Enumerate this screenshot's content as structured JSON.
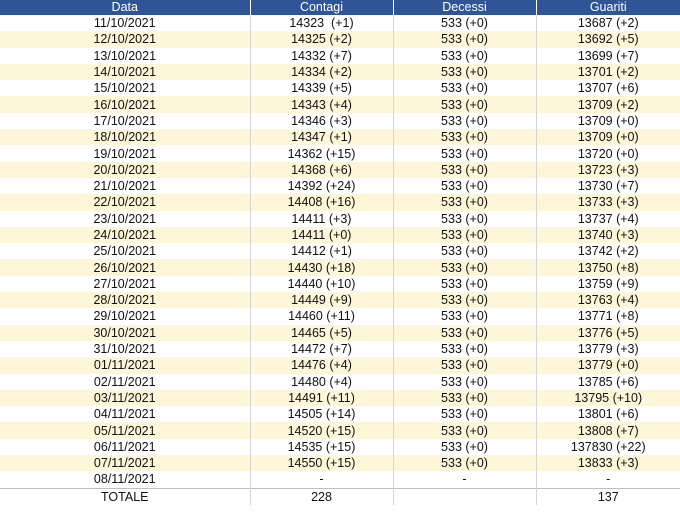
{
  "headers": [
    "Data",
    "Contagi",
    "Decessi",
    "Guariti"
  ],
  "rows": [
    [
      "11/10/2021",
      "14323  (+1)",
      "533 (+0)",
      "13687 (+2)"
    ],
    [
      "12/10/2021",
      "14325 (+2)",
      "533 (+0)",
      "13692 (+5)"
    ],
    [
      "13/10/2021",
      "14332 (+7)",
      "533 (+0)",
      "13699 (+7)"
    ],
    [
      "14/10/2021",
      "14334 (+2)",
      "533 (+0)",
      "13701 (+2)"
    ],
    [
      "15/10/2021",
      "14339 (+5)",
      "533 (+0)",
      "13707 (+6)"
    ],
    [
      "16/10/2021",
      "14343 (+4)",
      "533 (+0)",
      "13709 (+2)"
    ],
    [
      "17/10/2021",
      "14346 (+3)",
      "533 (+0)",
      "13709 (+0)"
    ],
    [
      "18/10/2021",
      "14347 (+1)",
      "533 (+0)",
      "13709 (+0)"
    ],
    [
      "19/10/2021",
      "14362 (+15)",
      "533 (+0)",
      "13720 (+0)"
    ],
    [
      "20/10/2021",
      "14368 (+6)",
      "533 (+0)",
      "13723 (+3)"
    ],
    [
      "21/10/2021",
      "14392 (+24)",
      "533 (+0)",
      "13730 (+7)"
    ],
    [
      "22/10/2021",
      "14408 (+16)",
      "533 (+0)",
      "13733 (+3)"
    ],
    [
      "23/10/2021",
      "14411 (+3)",
      "533 (+0)",
      "13737 (+4)"
    ],
    [
      "24/10/2021",
      "14411 (+0)",
      "533 (+0)",
      "13740 (+3)"
    ],
    [
      "25/10/2021",
      "14412 (+1)",
      "533 (+0)",
      "13742 (+2)"
    ],
    [
      "26/10/2021",
      "14430 (+18)",
      "533 (+0)",
      "13750 (+8)"
    ],
    [
      "27/10/2021",
      "14440 (+10)",
      "533 (+0)",
      "13759 (+9)"
    ],
    [
      "28/10/2021",
      "14449 (+9)",
      "533 (+0)",
      "13763 (+4)"
    ],
    [
      "29/10/2021",
      "14460 (+11)",
      "533 (+0)",
      "13771 (+8)"
    ],
    [
      "30/10/2021",
      "14465 (+5)",
      "533 (+0)",
      "13776 (+5)"
    ],
    [
      "31/10/2021",
      "14472 (+7)",
      "533 (+0)",
      "13779 (+3)"
    ],
    [
      "01/11/2021",
      "14476 (+4)",
      "533 (+0)",
      "13779 (+0)"
    ],
    [
      "02/11/2021",
      "14480 (+4)",
      "533 (+0)",
      "13785 (+6)"
    ],
    [
      "03/11/2021",
      "14491 (+11)",
      "533 (+0)",
      "13795 (+10)"
    ],
    [
      "04/11/2021",
      "14505 (+14)",
      "533 (+0)",
      "13801 (+6)"
    ],
    [
      "05/11/2021",
      "14520 (+15)",
      "533 (+0)",
      "13808 (+7)"
    ],
    [
      "06/11/2021",
      "14535 (+15)",
      "533 (+0)",
      "137830 (+22)"
    ],
    [
      "07/11/2021",
      "14550 (+15)",
      "533 (+0)",
      "13833 (+3)"
    ],
    [
      "08/11/2021",
      "-",
      "-",
      "-"
    ]
  ],
  "total": [
    "TOTALE",
    "228",
    "",
    "137"
  ]
}
